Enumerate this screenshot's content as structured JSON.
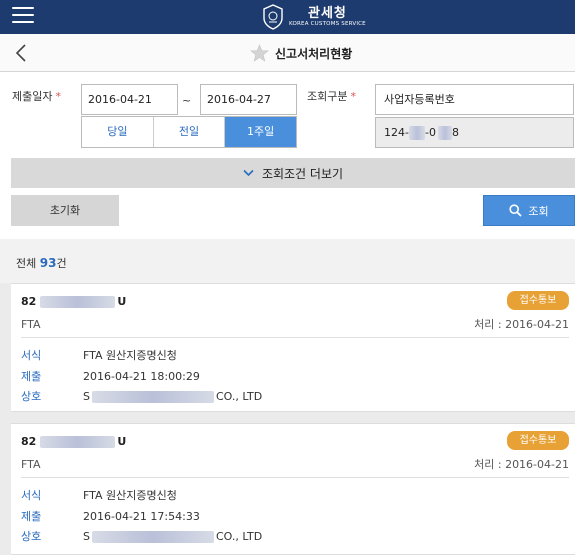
{
  "brand": {
    "name_ko": "관세청",
    "name_en": "KOREA CUSTOMS SERVICE"
  },
  "page": {
    "title": "신고서처리현황"
  },
  "form": {
    "date_label": "제출일자",
    "date_from": "2016-04-21",
    "date_sep": "~",
    "date_to": "2016-04-27",
    "periods": [
      "당일",
      "전일",
      "1주일"
    ],
    "active_period": "1주일",
    "query_label": "조회구분",
    "query_type": "사업자등록번호",
    "biz_no": {
      "prefix": "124-",
      "mid": "-0",
      "suffix": "8"
    },
    "required_mark": "*"
  },
  "more_conditions": "조회조건 더보기",
  "buttons": {
    "reset": "초기화",
    "search": "조회"
  },
  "summary": {
    "prefix": "전체 ",
    "count": "93",
    "suffix": "건"
  },
  "records": [
    {
      "no_prefix": "82",
      "no_suffix": "U",
      "status": "접수통보",
      "type": "FTA",
      "processed": "처리 : 2016-04-21",
      "form_label": "서식",
      "form_value": "FTA 원산지증명신청",
      "submit_label": "제출",
      "submit_value": "2016-04-21 18:00:29",
      "company_label": "상호",
      "company_prefix": "S",
      "company_suffix": "CO., LTD"
    },
    {
      "no_prefix": "82",
      "no_suffix": "U",
      "status": "접수통보",
      "type": "FTA",
      "processed": "처리 : 2016-04-21",
      "form_label": "서식",
      "form_value": "FTA 원산지증명신청",
      "submit_label": "제출",
      "submit_value": "2016-04-21 17:54:33",
      "company_label": "상호",
      "company_prefix": "S",
      "company_suffix": "CO., LTD"
    }
  ],
  "colors": {
    "header": "#1d3b6e",
    "accent": "#4a8fdc",
    "badge": "#e8a134",
    "link": "#2a6bbf"
  }
}
